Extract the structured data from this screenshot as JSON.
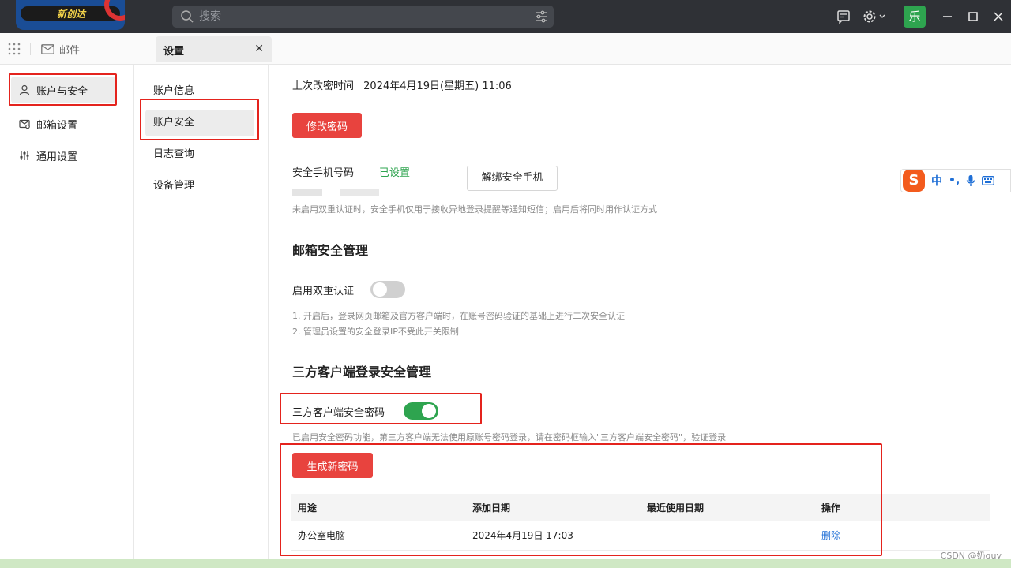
{
  "titlebar": {
    "logo_text": "新创达",
    "search_placeholder": "搜索",
    "avatar_text": "乐"
  },
  "tabs": {
    "mail_label": "邮件",
    "settings_label": "设置"
  },
  "leftnav": {
    "items": [
      {
        "label": "账户与安全",
        "icon": "user-icon"
      },
      {
        "label": "邮箱设置",
        "icon": "mailbox-settings-icon"
      },
      {
        "label": "通用设置",
        "icon": "sliders-icon"
      }
    ]
  },
  "subnav": {
    "items": [
      {
        "label": "账户信息"
      },
      {
        "label": "账户安全"
      },
      {
        "label": "日志查询"
      },
      {
        "label": "设备管理"
      }
    ]
  },
  "password": {
    "last_changed_label": "上次改密时间",
    "last_changed_value": "2024年4月19日(星期五) 11:06",
    "change_button": "修改密码"
  },
  "phone": {
    "label": "安全手机号码",
    "status": "已设置",
    "unbind_button": "解绑安全手机",
    "hint": "未启用双重认证时，安全手机仅用于接收异地登录提醒等通知短信；启用后将同时用作认证方式"
  },
  "mailbox_security": {
    "title": "邮箱安全管理",
    "two_factor_label": "启用双重认证",
    "two_factor_enabled": false,
    "note1": "1. 开启后，登录网页邮箱及官方客户端时，在账号密码验证的基础上进行二次安全认证",
    "note2": "2. 管理员设置的安全登录IP不受此开关限制"
  },
  "third_party": {
    "title": "三方客户端登录安全管理",
    "password_label": "三方客户端安全密码",
    "password_enabled": true,
    "hint": "已启用安全密码功能，第三方客户端无法使用原账号密码登录，请在密码框输入\"三方客户端安全密码\"，验证登录",
    "generate_button": "生成新密码",
    "table": {
      "headers": [
        "用途",
        "添加日期",
        "最近使用日期",
        "操作"
      ],
      "rows": [
        {
          "purpose": "办公室电脑",
          "added": "2024年4月19日 17:03",
          "last_used": "",
          "action": "删除"
        }
      ]
    }
  },
  "ime": {
    "chinese": "中",
    "punct": "•,"
  },
  "watermark": "CSDN @奶guy",
  "colors": {
    "accent_red": "#e8433e",
    "toggle_on": "#2ea44f",
    "link_blue": "#1f6fd6",
    "status_green": "#2ea44f"
  }
}
